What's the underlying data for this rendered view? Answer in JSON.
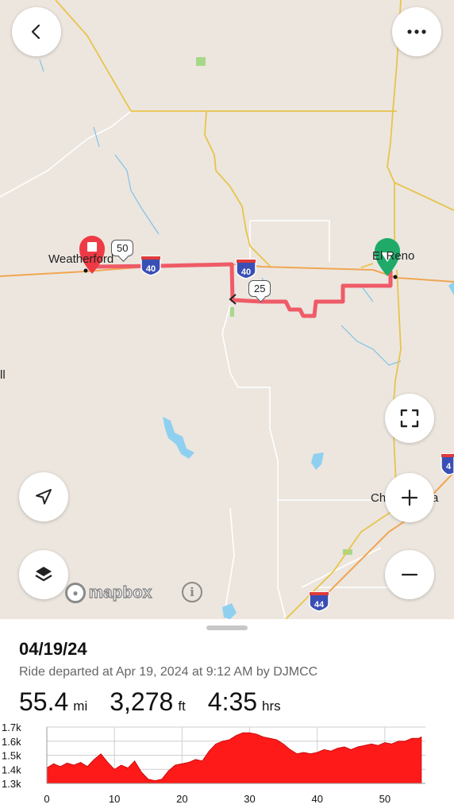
{
  "map": {
    "places": {
      "weatherford": "Weatherford",
      "el_reno": "El Reno",
      "left_edge_label": "ll",
      "ch_label": "Ch",
      "ch_label_tail": "a"
    },
    "highway_shields": [
      "40",
      "40",
      "44",
      "4"
    ],
    "mile_markers": [
      "50",
      "25"
    ],
    "attribution": {
      "logo_text": "mapbox",
      "info_glyph": "i"
    },
    "colors": {
      "route": "#ef5b67",
      "start": "#1faa6a",
      "end": "#ee3a45",
      "water": "#8fd0f0",
      "road": "#e8c44a",
      "interstate": "#3a4fb5",
      "background": "#ece6df"
    },
    "buttons": {
      "back": "chevron-left-icon",
      "more": "ellipsis-icon",
      "fullscreen": "fullscreen-icon",
      "locate": "navigation-arrow-icon",
      "zoom_in": "plus-icon",
      "layers": "layers-icon",
      "zoom_out": "minus-icon"
    }
  },
  "ride": {
    "date_title": "04/19/24",
    "subtitle": "Ride departed at Apr 19, 2024 at 9:12 AM by DJMCC",
    "stats": [
      {
        "value": "55.4",
        "unit": "mi"
      },
      {
        "value": "3,278",
        "unit": "ft"
      },
      {
        "value": "4:35",
        "unit": "hrs"
      }
    ]
  },
  "chart_data": {
    "type": "area",
    "title": "",
    "xlabel": "",
    "ylabel": "",
    "x_ticks": [
      "0",
      "10",
      "20",
      "30",
      "40",
      "50"
    ],
    "y_ticks": [
      "1.7k",
      "1.6k",
      "1.5k",
      "1.4k",
      "1.3k"
    ],
    "xlim": [
      0,
      56
    ],
    "ylim": [
      1300,
      1700
    ],
    "grid": true,
    "color": "#ff1a1a",
    "series": [
      {
        "x": [
          0,
          1,
          2,
          3,
          4,
          5,
          6,
          7,
          8,
          9,
          10,
          11,
          12,
          13,
          14,
          15,
          16,
          17,
          18,
          19,
          20,
          21,
          22,
          23,
          24,
          25,
          26,
          27,
          28,
          29,
          30,
          31,
          32,
          33,
          34,
          35,
          36,
          37,
          38,
          39,
          40,
          41,
          42,
          43,
          44,
          45,
          46,
          47,
          48,
          49,
          50,
          51,
          52,
          53,
          54,
          55,
          55.4
        ],
        "values": [
          1410,
          1440,
          1420,
          1445,
          1430,
          1450,
          1420,
          1470,
          1510,
          1450,
          1400,
          1430,
          1410,
          1460,
          1380,
          1330,
          1320,
          1330,
          1390,
          1430,
          1440,
          1450,
          1470,
          1460,
          1530,
          1580,
          1600,
          1610,
          1640,
          1660,
          1660,
          1650,
          1630,
          1620,
          1610,
          1580,
          1540,
          1510,
          1520,
          1510,
          1520,
          1540,
          1530,
          1550,
          1560,
          1540,
          1560,
          1570,
          1580,
          1570,
          1590,
          1580,
          1600,
          1600,
          1620,
          1620,
          1630
        ]
      }
    ]
  }
}
